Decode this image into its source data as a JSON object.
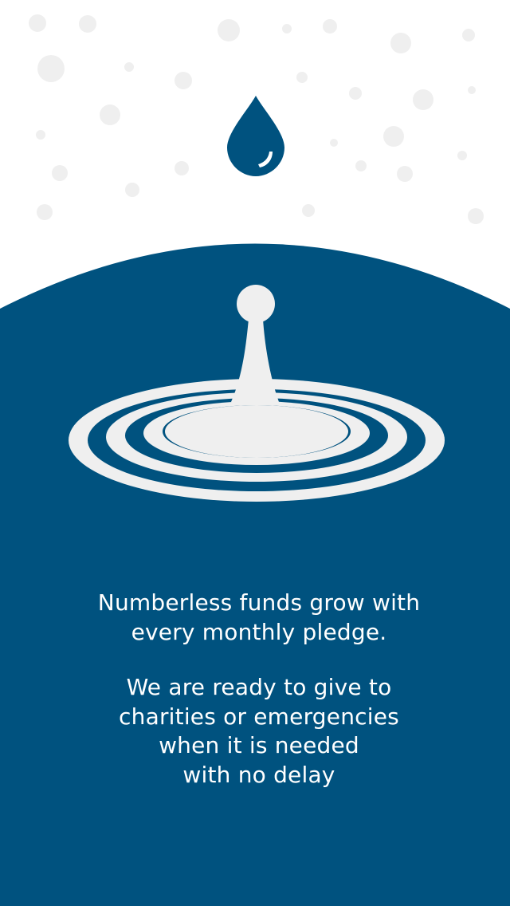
{
  "colors": {
    "brand_blue": "#00527f",
    "bubble_gray": "#efefef",
    "splash_white": "#efefef",
    "background": "#ffffff",
    "text": "#ffffff"
  },
  "icons": {
    "drop": "water-drop-icon",
    "splash": "water-splash-illustration"
  },
  "message": {
    "paragraph1": {
      "line1": "Numberless funds grow with",
      "line2": "every monthly pledge."
    },
    "paragraph2": {
      "line1": "We are ready to give to",
      "line2": "charities or emergencies",
      "line3": "when it is needed",
      "line4": "with no delay"
    }
  }
}
